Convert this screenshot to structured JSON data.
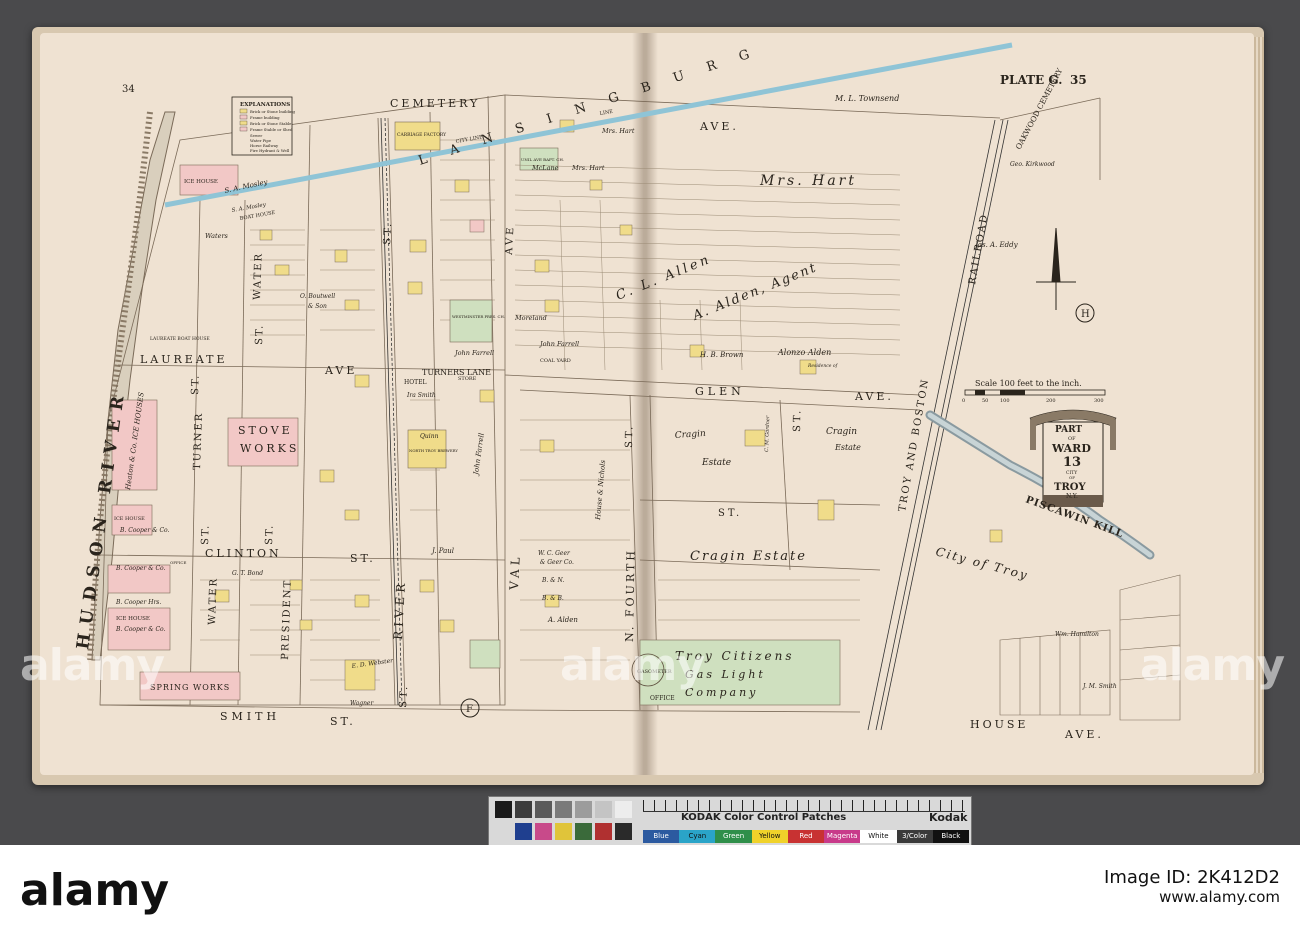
{
  "plate": {
    "left_page_number": "34",
    "right_heading": "PLATE G.",
    "right_page_number": "35"
  },
  "legend": {
    "title": "EXPLANATIONS",
    "items": [
      "Brick or Stone building",
      "Frame building",
      "Brick or Stone Stable",
      "Frame Stable or Shed",
      "Sewer",
      "Water Pipe",
      "Horse Railway",
      "Fire Hydrant & Well"
    ]
  },
  "cartouche": {
    "line1": "PART",
    "line2": "OF",
    "line3": "WARD",
    "line4": "13",
    "line5": "CITY",
    "line6": "OF",
    "line7": "TROY",
    "line8": "N.Y."
  },
  "scale": {
    "caption": "Scale 100 feet to the inch.",
    "ticks": [
      "0",
      "50",
      "100",
      "200",
      "300"
    ]
  },
  "section_markers": {
    "left": "F",
    "right": "H"
  },
  "map_labels": {
    "hudson_river": "HUDSON RIVER",
    "lansingburg": "L A N S I N G B U R G",
    "cemetery": "CEMETERY",
    "cemetery_ave": "AVE.",
    "oakwood_cemetery": "OAKWOOD CEMETERY",
    "ml_townsend": "M. L. Townsend",
    "mrs_hart": "Mrs. Hart",
    "mrs_hart_2": "Mrs. Hart",
    "mrs_hart_3": "Mrs. Hart",
    "mclane": "McLane",
    "cl_allen": "C. L. Allen",
    "a_alden_agent": "A. Alden, Agent",
    "jas_eddy": "Jas. A. Eddy",
    "hb_brown": "H. B. Brown",
    "alonzo_alden": "Alonzo Alden",
    "residence_of": "Residence of",
    "moreland": "Moreland",
    "john_farrell": "John Farrell",
    "john_farrell_2": "John Farrell",
    "coal_yard": "COAL YARD",
    "glen_ave": "GLEN",
    "glen_ave_2": "AVE.",
    "turners_lane": "TURNERS LANE",
    "laureate": "LAUREATE",
    "laureate_ave": "AVE",
    "laureate_boat_house": "LAUREATE BOAT HOUSE",
    "ice_house": "ICE HOUSE",
    "ice_house_2": "ICE HOUSE",
    "ice_house_3": "ICE HOUSE",
    "sa_mosley": "S. A. Mosley",
    "sa_mosley_2": "S. A. Mosley",
    "boat_house": "BOAT HOUSE",
    "waters": "Waters",
    "water_st": "WATER",
    "water_st_2": "ST.",
    "water_st_3": "WATER",
    "water_st_4": "ST.",
    "o_boutwell": "O. Boutwell",
    "and_son": "& Son",
    "westminster_church": "WESTMINSTER PRES. CH.",
    "carriage_factory": "CARRIAGE FACTORY",
    "bapt_ch": "UNIL AVE BAPT. CH.",
    "hotel": "HOTEL",
    "ira_smith": "Ira Smith",
    "store": "STORE",
    "stove": "STOVE",
    "works": "WORKS",
    "turner_st": "TURNER",
    "turner_st_2": "ST.",
    "quinn": "Quinn",
    "north_troy_brewery": "NORTH TROY BREWERY",
    "river_st": "RIVER",
    "river_st_2": "ST.",
    "river_st_top": "ST.",
    "val_ave": "VAL",
    "val_ave_2": "AVE",
    "clinton_st": "CLINTON",
    "clinton_st_2": "ST.",
    "b_cooper_co": "B. Cooper & Co.",
    "b_cooper_co_2": "B. Cooper & Co.",
    "b_cooper_co_3": "B. Cooper & Co.",
    "b_cooper_hrs": "B. Cooper Hrs.",
    "office": "OFFICE",
    "ice_houses_co": "Heaton & Co. ICE HOUSES",
    "gs_bond": "G. T. Bond",
    "president_st": "PRESIDENT",
    "president_st_2": "ST.",
    "j_paul": "J. Paul",
    "ed_webster": "E. D. Webster",
    "wagner": "Wagner",
    "spring_works": "SPRING WORKS",
    "smith_st": "SMITH",
    "smith_st_2": "ST.",
    "wc_geer": "W. C. Geer",
    "geer_co": "& Geer Co.",
    "house_nichols": "House & Nichols",
    "bn": "B. & N.",
    "bb": "B. & B.",
    "a_alden": "A. Alden",
    "n_fourth_st": "N. FOURTH",
    "n_fourth_st_2": "ST.",
    "cragin_estate": "Cragin",
    "cragin_estate_2": "Estate",
    "cragin_estate_3": "Cragin",
    "cragin_estate_4": "Estate",
    "cragin_estate_5": "Cragin Estate",
    "gardner": "C. M. Gardner",
    "st_right": "ST.",
    "st_right_2": "ST.",
    "troy_citizens": "Troy Citizens",
    "gas_light": "Gas Light",
    "company": "Company",
    "gasometer": "GASOMETER",
    "office_2": "OFFICE",
    "troy_and_boston": "TROY AND BOSTON",
    "railroad": "RAILROAD",
    "city_of_troy": "City of Troy",
    "piscawin_kill": "PISCAWIN KILL",
    "wm_hamilton": "Wm. Hamilton",
    "jm_smith": "J. M. Smith",
    "house_ave": "HOUSE",
    "house_ave_2": "AVE.",
    "ge_hall": "Geo. Kirkwood",
    "city_line": "CITY LINE",
    "line": "LINE"
  },
  "kodak_strip": {
    "title": "KODAK Color Control Patches",
    "brand": "Kodak",
    "patch_names": [
      "Blue",
      "Cyan",
      "Green",
      "Yellow",
      "Red",
      "Magenta",
      "White",
      "3/Color",
      "Black"
    ],
    "patch_colors": [
      "#2c5aa0",
      "#2aa4c8",
      "#2f8f4a",
      "#f0d22a",
      "#c83232",
      "#c83a8a",
      "#ffffff",
      "#3a3a3a",
      "#111111"
    ],
    "gray_patches": [
      "#1a1a1a",
      "#3c3c3c",
      "#5a5a5a",
      "#7a7a7a",
      "#9c9c9c",
      "#c4c4c4",
      "#ededed"
    ],
    "color_patches": [
      "#1f3f8f",
      "#c84a8a",
      "#e0c43a",
      "#3a6a3a",
      "#b03030",
      "#2a2a2a"
    ]
  },
  "watermark": {
    "logo": "alamy",
    "image_id": "Image ID: 2K412D2",
    "url": "www.alamy.com"
  },
  "colors": {
    "page": "#efe2d2",
    "brick": "#f0dc8a",
    "frame": "#f2c8c6",
    "water_blue": "#8fc4d6",
    "city_green": "#cfe0bf",
    "lines": "#5a4a3a"
  }
}
